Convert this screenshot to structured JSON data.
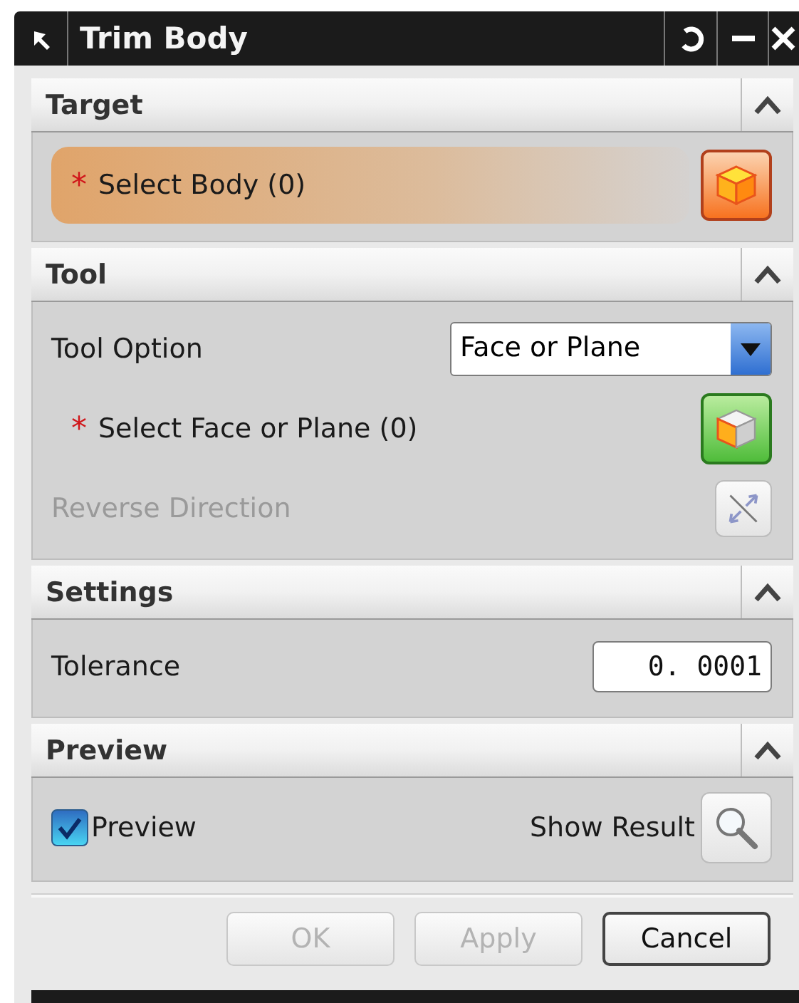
{
  "window": {
    "title": "Trim Body"
  },
  "sections": [
    {
      "title": "Target",
      "expanded": true,
      "rows": [
        {
          "kind": "selection",
          "marker": "*",
          "label": "Select Body (0)",
          "active": true
        }
      ]
    },
    {
      "title": "Tool",
      "expanded": true,
      "rows": [
        {
          "kind": "dropdown",
          "label": "Tool Option",
          "value": "Face or Plane"
        },
        {
          "kind": "selection",
          "marker": "*",
          "label": "Select Face or Plane (0)",
          "active": false
        },
        {
          "kind": "toggle",
          "label": "Reverse Direction",
          "disabled": true
        }
      ]
    },
    {
      "title": "Settings",
      "expanded": true,
      "rows": [
        {
          "kind": "number",
          "label": "Tolerance",
          "value": "0. 0001"
        }
      ]
    },
    {
      "title": "Preview",
      "expanded": true,
      "rows": [
        {
          "kind": "preview",
          "label": "Preview",
          "checked": true,
          "result_label": "Show Result"
        }
      ]
    }
  ],
  "buttons": [
    {
      "label": "OK",
      "disabled": true
    },
    {
      "label": "Apply",
      "disabled": true
    },
    {
      "label": "Cancel",
      "disabled": false
    }
  ]
}
